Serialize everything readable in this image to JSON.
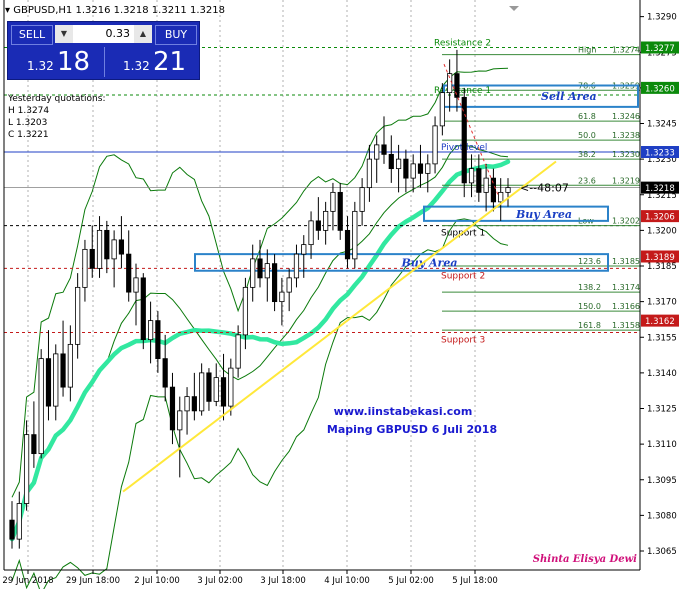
{
  "header": {
    "symbol_line": "GBPUSD,H1  1.3216 1.3218 1.3211 1.3218"
  },
  "trade_panel": {
    "sell_label": "SELL",
    "buy_label": "BUY",
    "lot": "0.33",
    "sell_price_prefix": "1.32",
    "sell_price_big": "18",
    "buy_price_prefix": "1.32",
    "buy_price_big": "21"
  },
  "yesterday": {
    "title": "Yesterday quotations:",
    "high": "H 1.3274",
    "low": "L 1.3203",
    "close": "C 1.3221"
  },
  "chart_data": {
    "type": "candlestick",
    "symbol": "GBPUSD",
    "timeframe": "H1",
    "ylim": [
      1.3057,
      1.3297
    ],
    "y_ticks": [
      "1.3290",
      "1.3275",
      "1.3260",
      "1.3245",
      "1.3230",
      "1.3215",
      "1.3200",
      "1.3185",
      "1.3170",
      "1.3155",
      "1.3140",
      "1.3125",
      "1.3110",
      "1.3095",
      "1.3080",
      "1.3065"
    ],
    "x_ticks": [
      "29 Jun 2018",
      "29 Jun 18:00",
      "2 Jul 10:00",
      "3 Jul 02:00",
      "3 Jul 18:00",
      "4 Jul 10:00",
      "5 Jul 02:00",
      "5 Jul 18:00"
    ],
    "price_tags": [
      {
        "label": "1.3277",
        "color": "#0b8a0b"
      },
      {
        "label": "1.3260",
        "color": "#0b8a0b"
      },
      {
        "label": "1.3233",
        "color": "#1f3fc4"
      },
      {
        "label": "1.3218",
        "color": "#000000"
      },
      {
        "label": "1.3206",
        "color": "#c41a1a"
      },
      {
        "label": "1.3189",
        "color": "#c41a1a"
      },
      {
        "label": "1.3162",
        "color": "#c41a1a"
      }
    ],
    "fib_levels": [
      {
        "label": "High",
        "price": "1.3274"
      },
      {
        "label": "78.6",
        "price": "1.3259"
      },
      {
        "label": "61.8",
        "price": "1.3246"
      },
      {
        "label": "50.0",
        "price": "1.3238"
      },
      {
        "label": "38.2",
        "price": "1.3230"
      },
      {
        "label": "23.6",
        "price": "1.3219"
      },
      {
        "label": "Low",
        "price": "1.3202"
      },
      {
        "label": "123.6",
        "price": "1.3185"
      },
      {
        "label": "138.2",
        "price": "1.3174"
      },
      {
        "label": "150.0",
        "price": "1.3166"
      },
      {
        "label": "161.8",
        "price": "1.3158"
      }
    ],
    "pivot_labels": [
      {
        "label": "Resistance 2",
        "price": 1.3277,
        "color": "#0b8a0b"
      },
      {
        "label": "Resistance 1",
        "price": 1.3257,
        "color": "#0b8a0b"
      },
      {
        "label": "Pivot level",
        "price": 1.3233,
        "color": "#1f3fc4"
      },
      {
        "label": "Support 1",
        "price": 1.3202,
        "color": "#000000"
      },
      {
        "label": "Support 2",
        "price": 1.3184,
        "color": "#c41a1a"
      },
      {
        "label": "Support 3",
        "price": 1.3157,
        "color": "#c41a1a"
      }
    ],
    "zones": [
      {
        "label": "Sell Area",
        "top": 1.3261,
        "bottom": 1.3252
      },
      {
        "label": "Buy Area",
        "top": 1.321,
        "bottom": 1.3204
      },
      {
        "label": "Buy Area",
        "top": 1.319,
        "bottom": 1.3183
      }
    ],
    "countdown": "<--48:07",
    "watermark_site": "www.iinstabekasi.com",
    "watermark_title": "Maping GBPUSD 6 Juli 2018",
    "author": "Shinta Elisya Dewi",
    "candles": [
      [
        1.3078,
        1.3086,
        1.3066,
        1.307
      ],
      [
        1.307,
        1.309,
        1.3066,
        1.3085
      ],
      [
        1.3085,
        1.312,
        1.3082,
        1.3114
      ],
      [
        1.3114,
        1.3128,
        1.31,
        1.3106
      ],
      [
        1.3106,
        1.315,
        1.3104,
        1.3146
      ],
      [
        1.3146,
        1.3158,
        1.312,
        1.3126
      ],
      [
        1.3126,
        1.3152,
        1.312,
        1.3148
      ],
      [
        1.3148,
        1.3162,
        1.313,
        1.3134
      ],
      [
        1.3134,
        1.316,
        1.3128,
        1.3152
      ],
      [
        1.3152,
        1.3182,
        1.3146,
        1.3176
      ],
      [
        1.3176,
        1.3196,
        1.317,
        1.3192
      ],
      [
        1.3192,
        1.3202,
        1.318,
        1.3184
      ],
      [
        1.3184,
        1.3206,
        1.318,
        1.32
      ],
      [
        1.32,
        1.3204,
        1.3182,
        1.3188
      ],
      [
        1.3188,
        1.32,
        1.3176,
        1.3196
      ],
      [
        1.3196,
        1.3206,
        1.3184,
        1.319
      ],
      [
        1.319,
        1.32,
        1.317,
        1.3174
      ],
      [
        1.3174,
        1.3186,
        1.316,
        1.318
      ],
      [
        1.318,
        1.3182,
        1.315,
        1.3154
      ],
      [
        1.3154,
        1.317,
        1.3144,
        1.3162
      ],
      [
        1.3162,
        1.3166,
        1.314,
        1.3146
      ],
      [
        1.3146,
        1.3156,
        1.3128,
        1.3134
      ],
      [
        1.3134,
        1.314,
        1.311,
        1.3116
      ],
      [
        1.3116,
        1.313,
        1.3096,
        1.3124
      ],
      [
        1.3124,
        1.3134,
        1.3114,
        1.313
      ],
      [
        1.313,
        1.314,
        1.312,
        1.3124
      ],
      [
        1.3124,
        1.3144,
        1.3122,
        1.314
      ],
      [
        1.314,
        1.3142,
        1.3124,
        1.3128
      ],
      [
        1.3128,
        1.3144,
        1.3126,
        1.3138
      ],
      [
        1.3138,
        1.3148,
        1.312,
        1.3126
      ],
      [
        1.3126,
        1.3146,
        1.3122,
        1.3142
      ],
      [
        1.3142,
        1.316,
        1.3138,
        1.3156
      ],
      [
        1.3156,
        1.318,
        1.315,
        1.3176
      ],
      [
        1.3176,
        1.3194,
        1.317,
        1.3188
      ],
      [
        1.3188,
        1.3196,
        1.3176,
        1.318
      ],
      [
        1.318,
        1.3192,
        1.317,
        1.3186
      ],
      [
        1.3186,
        1.319,
        1.3166,
        1.317
      ],
      [
        1.317,
        1.318,
        1.316,
        1.3174
      ],
      [
        1.3174,
        1.3184,
        1.3166,
        1.318
      ],
      [
        1.318,
        1.3194,
        1.3176,
        1.319
      ],
      [
        1.319,
        1.3198,
        1.318,
        1.3194
      ],
      [
        1.3194,
        1.3208,
        1.3188,
        1.3204
      ],
      [
        1.3204,
        1.3214,
        1.3196,
        1.32
      ],
      [
        1.32,
        1.3212,
        1.3194,
        1.3208
      ],
      [
        1.3208,
        1.322,
        1.32,
        1.3216
      ],
      [
        1.3216,
        1.322,
        1.3196,
        1.32
      ],
      [
        1.32,
        1.3206,
        1.3184,
        1.3188
      ],
      [
        1.3188,
        1.3212,
        1.3184,
        1.3208
      ],
      [
        1.3208,
        1.3222,
        1.3202,
        1.3218
      ],
      [
        1.3218,
        1.3236,
        1.3212,
        1.323
      ],
      [
        1.323,
        1.324,
        1.322,
        1.3236
      ],
      [
        1.3236,
        1.3248,
        1.3228,
        1.3232
      ],
      [
        1.3232,
        1.324,
        1.322,
        1.3226
      ],
      [
        1.3226,
        1.3236,
        1.3216,
        1.323
      ],
      [
        1.323,
        1.3234,
        1.3216,
        1.3222
      ],
      [
        1.3222,
        1.3232,
        1.3216,
        1.3228
      ],
      [
        1.3228,
        1.3236,
        1.3218,
        1.3224
      ],
      [
        1.3224,
        1.3232,
        1.3216,
        1.3228
      ],
      [
        1.3228,
        1.3248,
        1.3224,
        1.3244
      ],
      [
        1.3244,
        1.3262,
        1.324,
        1.3258
      ],
      [
        1.3258,
        1.3272,
        1.325,
        1.3266
      ],
      [
        1.3266,
        1.3276,
        1.325,
        1.3256
      ],
      [
        1.3256,
        1.326,
        1.3214,
        1.322
      ],
      [
        1.322,
        1.3232,
        1.3214,
        1.3226
      ],
      [
        1.3226,
        1.3232,
        1.3212,
        1.3216
      ],
      [
        1.3216,
        1.3228,
        1.3208,
        1.3222
      ],
      [
        1.3222,
        1.3226,
        1.3208,
        1.3212
      ],
      [
        1.3212,
        1.3222,
        1.3204,
        1.3216
      ],
      [
        1.3216,
        1.3222,
        1.321,
        1.3218
      ]
    ]
  }
}
